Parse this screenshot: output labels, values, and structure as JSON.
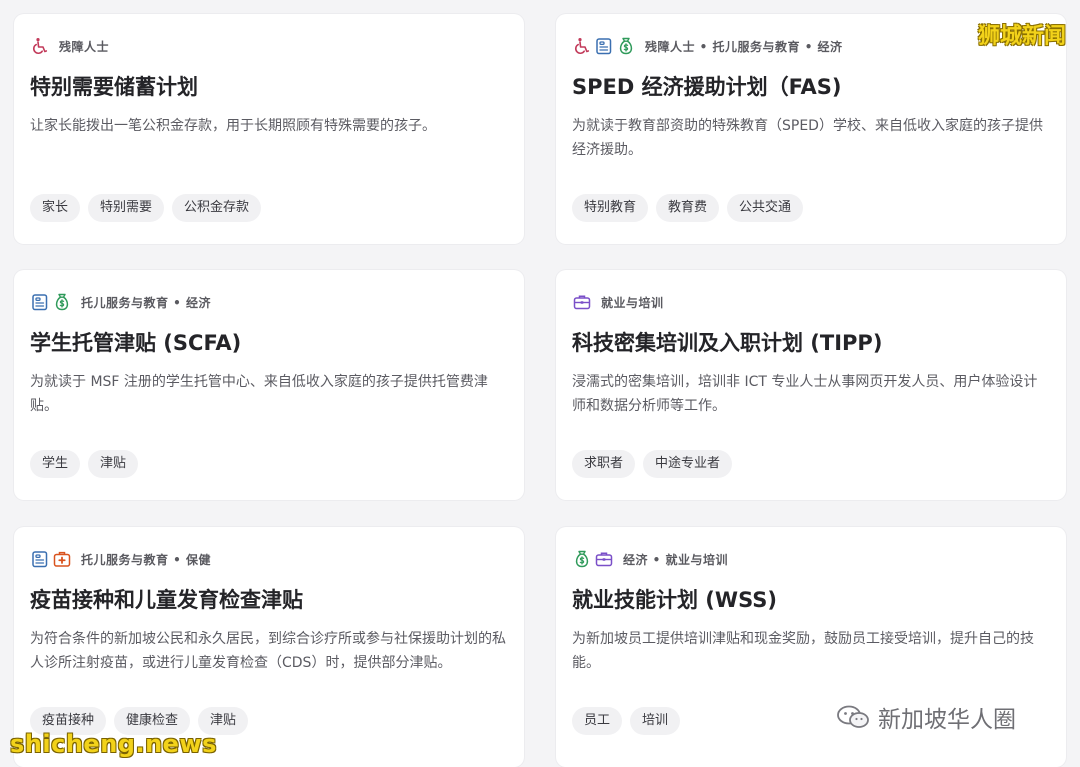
{
  "colors": {
    "disability": "#c23a5a",
    "childcare": "#3a6fb0",
    "finance": "#2f9a5a",
    "employment": "#7a4fc8",
    "health": "#d9531e"
  },
  "cards": [
    {
      "icons": [
        "wheelchair-icon"
      ],
      "category": "残障人士",
      "title": "特别需要储蓄计划",
      "description": "让家长能拨出一笔公积金存款，用于长期照顾有特殊需要的孩子。",
      "tags": [
        "家长",
        "特别需要",
        "公积金存款"
      ]
    },
    {
      "icons": [
        "wheelchair-icon",
        "childcare-icon",
        "money-bag-icon"
      ],
      "category": "残障人士 • 托儿服务与教育 • 经济",
      "title": "SPED 经济援助计划（FAS)",
      "description": "为就读于教育部资助的特殊教育（SPED）学校、来自低收入家庭的孩子提供经济援助。",
      "tags": [
        "特别教育",
        "教育费",
        "公共交通"
      ]
    },
    {
      "icons": [
        "childcare-icon",
        "money-bag-icon"
      ],
      "category": "托儿服务与教育 • 经济",
      "title": "学生托管津贴 (SCFA)",
      "description": "为就读于 MSF 注册的学生托管中心、来自低收入家庭的孩子提供托管费津贴。",
      "tags": [
        "学生",
        "津贴"
      ]
    },
    {
      "icons": [
        "briefcase-icon"
      ],
      "category": "就业与培训",
      "title": "科技密集培训及入职计划 (TIPP)",
      "description": "浸濡式的密集培训，培训非 ICT 专业人士从事网页开发人员、用户体验设计师和数据分析师等工作。",
      "tags": [
        "求职者",
        "中途专业者"
      ]
    },
    {
      "icons": [
        "childcare-icon",
        "medical-kit-icon"
      ],
      "category": "托儿服务与教育 • 保健",
      "title": "疫苗接种和儿童发育检查津贴",
      "description": "为符合条件的新加坡公民和永久居民，到综合诊疗所或参与社保援助计划的私人诊所注射疫苗，或进行儿童发育检查（CDS）时，提供部分津贴。",
      "tags": [
        "疫苗接种",
        "健康检查",
        "津贴"
      ]
    },
    {
      "icons": [
        "money-bag-icon",
        "briefcase-icon"
      ],
      "category": "经济 • 就业与培训",
      "title": "就业技能计划 (WSS)",
      "description": "为新加坡员工提供培训津贴和现金奖励，鼓励员工接受培训，提升自己的技能。",
      "tags": [
        "员工",
        "培训"
      ]
    }
  ],
  "watermarks": {
    "top_right": "狮城新闻",
    "bottom_left": "shicheng.news",
    "wechat": "新加坡华人圈"
  }
}
